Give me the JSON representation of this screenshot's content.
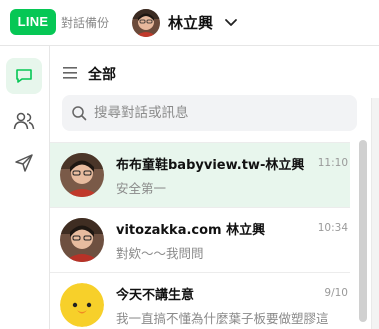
{
  "header": {
    "logo_text": "LINE",
    "backup_label": "對話備份",
    "account_name": "林立興"
  },
  "list": {
    "title": "全部",
    "search_placeholder": "搜尋對話或訊息"
  },
  "chats": [
    {
      "name": "布布童鞋babyview.tw-林立興",
      "message": "安全第一",
      "time": "11:10",
      "avatar": "person-photo",
      "selected": true
    },
    {
      "name": "vitozakka.com 林立興",
      "message": "對欸～～我問問",
      "time": "10:34",
      "avatar": "person-photo",
      "selected": false
    },
    {
      "name": "今天不講生意",
      "message": "我一直搞不懂為什麼葉子板要做塑膠這",
      "time": "9/10",
      "avatar": "sally-chick",
      "selected": false
    }
  ],
  "colors": {
    "brand": "#06c755",
    "selected_row": "#e8f6ed"
  }
}
